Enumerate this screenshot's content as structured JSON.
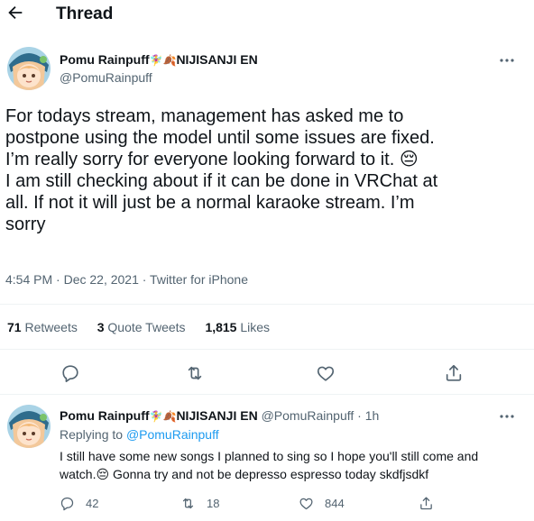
{
  "header": {
    "title": "Thread"
  },
  "main_tweet": {
    "display_name": "Pomu Rainpuff",
    "name_emoji": "🧚‍♀️🍂",
    "name_suffix": "NIJISANJI EN",
    "handle": "@PomuRainpuff",
    "text_lines": [
      "For todays stream, management has asked me to",
      "postpone using the model until some issues are fixed.",
      "I’m really sorry for everyone looking forward to it. 😔",
      "I am still checking about if it can be done in VRChat at",
      "all. If not it will just be a normal karaoke stream. I’m",
      "sorry"
    ],
    "timestamp": "4:54 PM · Dec 22, 2021 · Twitter for iPhone",
    "stats": {
      "retweets_count": "71",
      "retweets_label": "Retweets",
      "quotes_count": "3",
      "quotes_label": "Quote Tweets",
      "likes_count": "1,815",
      "likes_label": "Likes"
    }
  },
  "reply_tweet": {
    "display_name": "Pomu Rainpuff",
    "name_emoji": "🧚‍♀️🍂",
    "name_suffix": "NIJISANJI EN",
    "handle_time": "@PomuRainpuff · 1h",
    "replying_label": "Replying to",
    "replying_handle": "@PomuRainpuff",
    "text_lines": [
      "I still have some new songs I planned to sing so I hope you'll still come and",
      "watch.😔 Gonna try and not be depresso espresso today skdfjsdkf"
    ],
    "reply_count": "42",
    "retweet_count": "18",
    "like_count": "844"
  },
  "icons": [
    "arrow-left-icon",
    "more-icon",
    "reply-icon",
    "retweet-icon",
    "like-icon",
    "share-icon"
  ],
  "colors": {
    "text": "#0f1419",
    "secondary": "#536471",
    "link": "#1d9bf0",
    "divider": "#eff3f4"
  }
}
